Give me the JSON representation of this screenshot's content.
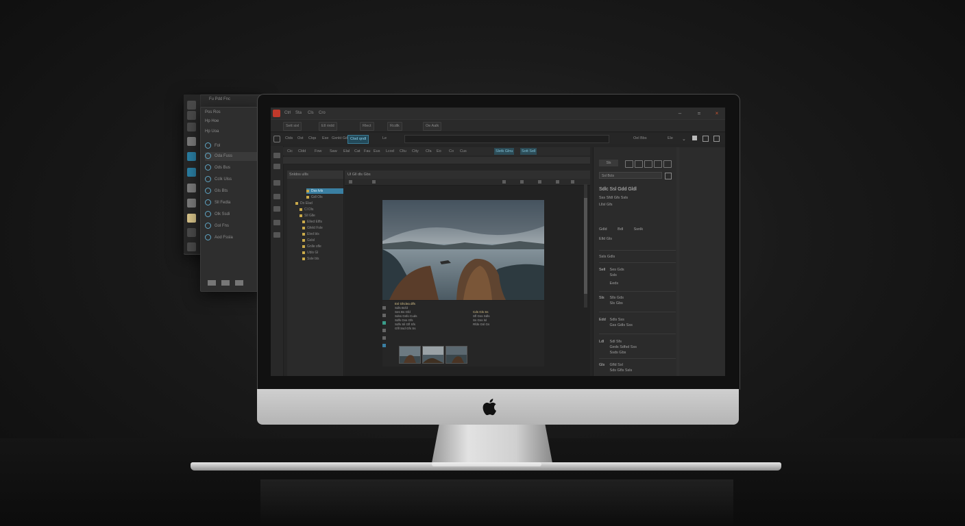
{
  "colors": {
    "background": "#1a1a1a",
    "accent_blue": "#3a7fa2",
    "app_badge": "#c0392b",
    "folder": "#c9a94a",
    "info_gold": "#d8c38a"
  },
  "app": {
    "menu": [
      "Ctrl",
      "Sta",
      "Cls",
      "Cro"
    ],
    "window_controls": {
      "minimize": "–",
      "maximize": "=",
      "close": "×"
    }
  },
  "options_bar": [
    "Sett sixl",
    "Ell rirdd",
    "Rlect",
    "Rcdlk",
    "Oe Aalk"
  ],
  "path_bar": {
    "segments": [
      "Ctds",
      "Ost",
      "Ctqs",
      "Ese",
      "Gxnkt Gdes",
      "Ctsd qndl",
      "Le"
    ],
    "active_segment": "Ctsd qndl",
    "right_items": [
      "Oel Bbs",
      "Ele"
    ]
  },
  "tabs": [
    "Cic",
    "Cldd",
    "Fow",
    "Saw",
    "Elal",
    "Cat",
    "Fau",
    "Eus",
    "Lcod",
    "Cltu",
    "Ctty",
    "Cfa",
    "Eo",
    "Co",
    "Cus"
  ],
  "highlighted_tabs": [
    "Sletk Glnu",
    "Sott Sell"
  ],
  "back_panel": {
    "header": [
      "Fu Pdd Fnc",
      "Pos Ros",
      "Hp Hoe",
      "Hp Uoa"
    ],
    "items": [
      {
        "label": "Oda Fuss",
        "selected": true
      },
      {
        "label": "Ods Bus"
      },
      {
        "label": "Cclk Ulss"
      },
      {
        "label": "Gls Bts"
      },
      {
        "label": "Sll Fedla"
      },
      {
        "label": "Olk Ssdi"
      },
      {
        "label": "Gol Fns"
      },
      {
        "label": "Aod Fssla"
      }
    ]
  },
  "tree": {
    "header": "Snldos ullls",
    "rows": [
      {
        "label": "Dss lvls",
        "selected": true
      },
      {
        "label": "Gdl Ols"
      },
      {
        "label": "Do Elad"
      },
      {
        "label": "Cl Dls"
      },
      {
        "label": "Sll Glle"
      },
      {
        "label": "Elled Elfls"
      },
      {
        "label": "Gfeld Fsle"
      },
      {
        "label": "Eled bls"
      },
      {
        "label": "Gslsl"
      },
      {
        "label": "Gnlle sfle"
      },
      {
        "label": "Ubls Gl"
      },
      {
        "label": "Ssle bls"
      }
    ]
  },
  "canvas": {
    "header": "Ul Gll dls Gbs",
    "info_left": [
      {
        "text": "Esl Ghclea dlfs",
        "gold": true
      },
      {
        "text": "Sdls Bcfd"
      },
      {
        "text": "Ses Bs Gfd"
      },
      {
        "text": "Sdss Gsfo Cuds"
      },
      {
        "text": "Sdfs Gss Gfs"
      },
      {
        "text": "Sdfs Sil Gfl Sfs"
      },
      {
        "text": "Gfll Ssd Gfs Ss"
      }
    ],
    "info_right": [
      {
        "text": "Cds Gls Ss",
        "gold": true
      },
      {
        "text": "Sfl Gss Sdls"
      },
      {
        "text": "Ss Gss lsl"
      },
      {
        "text": "Rfds Gsl Gs"
      }
    ]
  },
  "right_panel": {
    "dropdown": "Ssl Bcts",
    "title": "Sdlc Ssl Gdd Gldl",
    "subtitle": "Sss Sfdl Gfs Ssls",
    "line3": "Lllsl Gfs",
    "row1": [
      "Gdld",
      "Bdl",
      "Ssnlk"
    ],
    "row2": "Elld Gls",
    "section1": "Ssls Gdls",
    "items": [
      {
        "icon": "Sell",
        "lines": [
          "Ses Gds",
          "Ssls",
          "Eeds"
        ]
      },
      {
        "icon": "Sls",
        "lines": [
          "Slls Gds",
          "Sls Gbs"
        ]
      },
      {
        "icon": "Edd",
        "lines": [
          "Sdls Sss",
          "Gss Gdls Sss"
        ]
      },
      {
        "icon": "Ldl",
        "lines": [
          "Sdl Sfs",
          "Geds Sdfsd Sss",
          "Ssds Gbs"
        ]
      },
      {
        "icon": "Gls",
        "lines": [
          "Gfld Ssl",
          "Sds Gfls Ssls"
        ]
      }
    ]
  }
}
